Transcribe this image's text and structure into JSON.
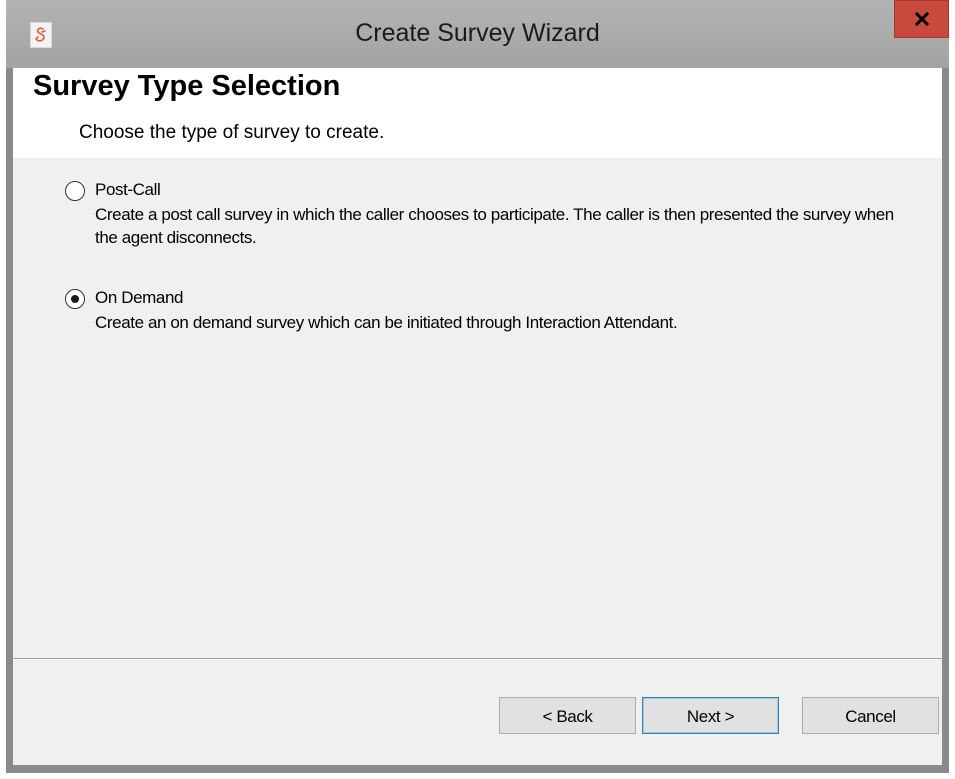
{
  "window": {
    "title": "Create Survey Wizard",
    "icon": "app-logo-icon",
    "close_icon": "close-icon"
  },
  "header": {
    "title": "Survey Type Selection",
    "subtitle": "Choose the type of survey to create."
  },
  "options": [
    {
      "label": "Post-Call",
      "description": "Create a post call survey in which the caller chooses to participate.  The caller is then presented the survey when the agent disconnects.",
      "selected": false
    },
    {
      "label": "On Demand",
      "description": "Create an on demand survey which can be initiated through Interaction Attendant.",
      "selected": true
    }
  ],
  "buttons": {
    "back": "< Back",
    "next": "Next >",
    "cancel": "Cancel"
  },
  "colors": {
    "titlebar": "#a9a9a9",
    "close_button": "#c74a3c",
    "client_background": "#f0f0f0",
    "header_background": "#ffffff",
    "logo": "#e8563f"
  }
}
